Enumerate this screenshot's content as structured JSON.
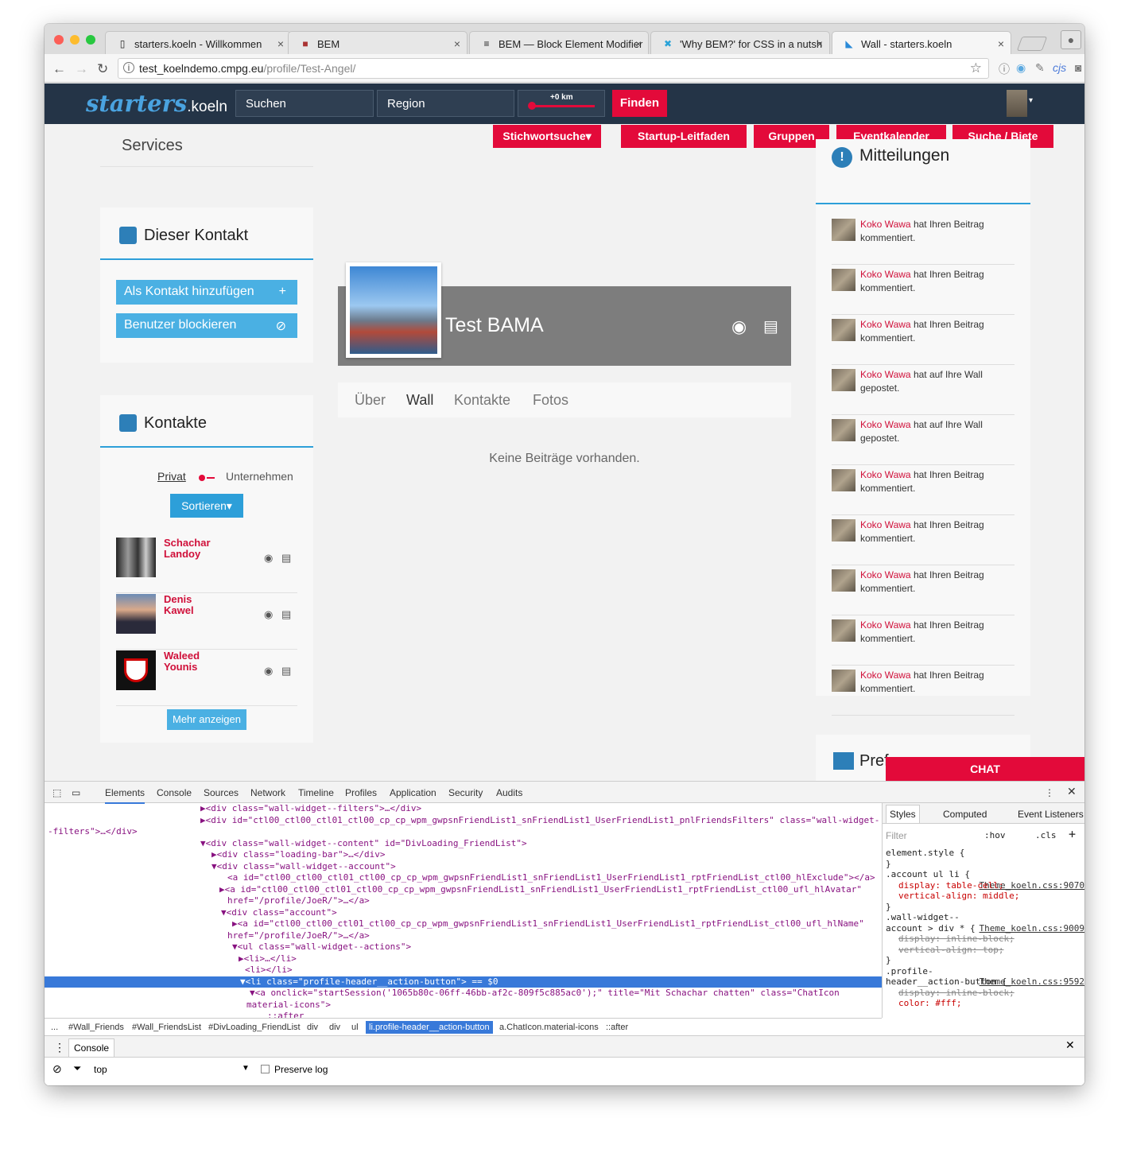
{
  "browser": {
    "tabs": [
      "starters.koeln - Willkommen",
      "BEM",
      "BEM — Block Element Modifier",
      "'Why BEM?' for CSS in a nutsh",
      "Wall - starters.koeln"
    ],
    "url_host": "test_koelndemo.cmpg.eu",
    "url_path": "/profile/Test-Angel/",
    "ext_cjs": "cjs"
  },
  "header": {
    "logo": "starters",
    "logo_suffix": ".koeln",
    "search_placeholder": "Suchen",
    "region_placeholder": "Region",
    "range_label": "+0 km",
    "find_button": "Finden"
  },
  "nav": {
    "items": [
      "Stichwortsuche",
      "Startup-Leitfaden",
      "Gruppen",
      "Eventkalender",
      "Suche / Biete"
    ]
  },
  "left": {
    "services": "Services",
    "contact_title": "Dieser Kontakt",
    "add_contact": "Als Kontakt hinzufügen",
    "block_user": "Benutzer blockieren",
    "contacts_title": "Kontakte",
    "toggle_private": "Privat",
    "toggle_company": "Unternehmen",
    "sort_button": "Sortieren",
    "contacts": [
      {
        "first": "Schachar",
        "last": "Landoy"
      },
      {
        "first": "Denis",
        "last": "Kawel"
      },
      {
        "first": "Waleed",
        "last": "Younis"
      }
    ],
    "more": "Mehr anzeigen"
  },
  "profile": {
    "name": "Test BAMA",
    "tabs": [
      "Über",
      "Wall",
      "Kontakte",
      "Fotos"
    ],
    "empty": "Keine Beiträge vorhanden."
  },
  "notifications": {
    "title": "Mitteilungen",
    "items": [
      {
        "user": "Koko Wawa",
        "text": "hat Ihren Beitrag kommentiert."
      },
      {
        "user": "Koko Wawa",
        "text": "hat Ihren Beitrag kommentiert."
      },
      {
        "user": "Koko Wawa",
        "text": "hat Ihren Beitrag kommentiert."
      },
      {
        "user": "Koko Wawa",
        "text": "hat auf Ihre Wall gepostet."
      },
      {
        "user": "Koko Wawa",
        "text": "hat auf Ihre Wall gepostet."
      },
      {
        "user": "Koko Wawa",
        "text": "hat Ihren Beitrag kommentiert."
      },
      {
        "user": "Koko Wawa",
        "text": "hat Ihren Beitrag kommentiert."
      },
      {
        "user": "Koko Wawa",
        "text": "hat Ihren Beitrag kommentiert."
      },
      {
        "user": "Koko Wawa",
        "text": "hat Ihren Beitrag kommentiert."
      },
      {
        "user": "Koko Wawa",
        "text": "hat Ihren Beitrag kommentiert."
      }
    ],
    "next_panel": "Pref"
  },
  "chat": "CHAT",
  "devtools": {
    "tabs": [
      "Elements",
      "Console",
      "Sources",
      "Network",
      "Timeline",
      "Profiles",
      "Application",
      "Security",
      "Audits"
    ],
    "styles_tabs": [
      "Styles",
      "Computed",
      "Event Listeners"
    ],
    "filter": "Filter",
    "hov": ":hov",
    "cls": ".cls",
    "rules": [
      "element.style {",
      "}",
      ".account ul li {",
      "Theme_koeln.css:9070",
      "display: table-cell;",
      "vertical-align: middle;",
      "}",
      ".wall-widget--",
      "Theme_koeln.css:9009",
      "account > div * {",
      "display: inline-block;",
      "vertical-align: top;",
      "}",
      ".profile-",
      "Theme_koeln.css:9592",
      "header__action-button {",
      "display: inline-block;",
      "color: #fff;"
    ],
    "breadcrumbs": [
      "...",
      "#Wall_Friends",
      "#Wall_FriendsList",
      "#DivLoading_FriendList",
      "div",
      "div",
      "ul",
      "li.profile-header__action-button",
      "a.ChatIcon.material-icons",
      "::after"
    ],
    "console_tab": "Console",
    "console_context": "top",
    "preserve_log": "Preserve log",
    "code_lines": [
      "▶<div class=\"wall-widget--filters\">…</div>",
      "▶<div id=\"ctl00_ctl00_ctl01_ctl00_cp_cp_wpm_gwpsnFriendList1_snFriendList1_UserFriendList1_pnlFriendsFilters\" class=\"wall-widget-",
      "-filters\">…</div>",
      "▼<div class=\"wall-widget--content\" id=\"DivLoading_FriendList\">",
      "▶<div class=\"loading-bar\">…</div>",
      "▼<div class=\"wall-widget--account\">",
      "<a id=\"ctl00_ctl00_ctl01_ctl00_cp_cp_wpm_gwpsnFriendList1_snFriendList1_UserFriendList1_rptFriendList_ctl00_hlExclude\"></a>",
      "▶<a id=\"ctl00_ctl00_ctl01_ctl00_cp_cp_wpm_gwpsnFriendList1_snFriendList1_UserFriendList1_rptFriendList_ctl00_ufl_hlAvatar\"",
      "href=\"/profile/JoeR/\">…</a>",
      "▼<div class=\"account\">",
      "▶<a id=\"ctl00_ctl00_ctl01_ctl00_cp_cp_wpm_gwpsnFriendList1_snFriendList1_UserFriendList1_rptFriendList_ctl00_ufl_hlName\"",
      "href=\"/profile/JoeR/\">…</a>",
      "▼<ul class=\"wall-widget--actions\">",
      "▶<li>…</li>",
      "<li></li>",
      "▼<li class=\"profile-header__action-button\"> == $0",
      "▼<a onclick=\"startSession('1065b80c-06ff-46bb-af2c-809f5c885ac0');\" title=\"Mit Schachar chatten\" class=\"ChatIcon",
      "material-icons\">",
      "::after"
    ]
  }
}
